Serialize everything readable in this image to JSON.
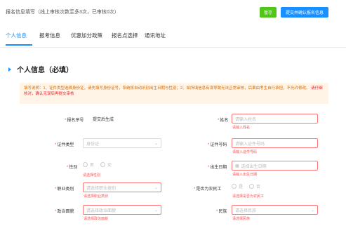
{
  "topbar": {
    "title": "报名信息填写（线上审核次数至多3次，已审核0次）",
    "save_label": "暂存",
    "confirm_label": "提交并确认报名信息"
  },
  "tabs": [
    "个人信息",
    "报考信息",
    "优惠加分政策",
    "报名点选择",
    "通讯地址"
  ],
  "section": {
    "title": "个人信息（必填）"
  },
  "notice": {
    "text": "填写说明：1、证件类型选择身份证，请先填写身份证号，系统将自动识别出生日期与性别；2、如所填信息有误导致无法正常审核，后果由考生自行承担，不允许修改。",
    "emphasis": "请仔细核对，确认无误后再提交审核"
  },
  "form": {
    "index": {
      "label": "报名序号",
      "value": "提交后生成"
    },
    "name": {
      "label": "姓名",
      "placeholder": "请输入姓名",
      "error": "请输入姓名"
    },
    "id_type": {
      "label": "证件类型",
      "value": "身份证"
    },
    "id_number": {
      "label": "证件号码",
      "placeholder": "请输入证件号码",
      "error": "请输入证件号码"
    },
    "gender": {
      "label": "性别",
      "opt1": "男",
      "opt2": "女",
      "error": "请选择性别"
    },
    "birth_date": {
      "label": "出生日期",
      "placeholder": "选择出生日期",
      "error": "请输入出生日期"
    },
    "occupation": {
      "label": "职业类别",
      "placeholder": "请选择职业类别",
      "error": "请选择职业类别"
    },
    "migrant": {
      "label": "是否为农民工",
      "opt1": "是",
      "opt2": "否",
      "error": "请选择是否为农民工"
    },
    "political": {
      "label": "政治面貌",
      "placeholder": "请选择政治面貌",
      "error": "请选择政治面貌"
    },
    "ethnicity": {
      "label": "民族",
      "placeholder": "请选择民族",
      "error": "请选择民族"
    }
  },
  "icons": {
    "chevron": "chevron-down-icon",
    "calendar": "calendar-icon"
  },
  "colors": {
    "primary": "#1890ff",
    "success": "#52c41a",
    "error": "#ff4d4f",
    "notice_bg": "#fff4e6"
  }
}
